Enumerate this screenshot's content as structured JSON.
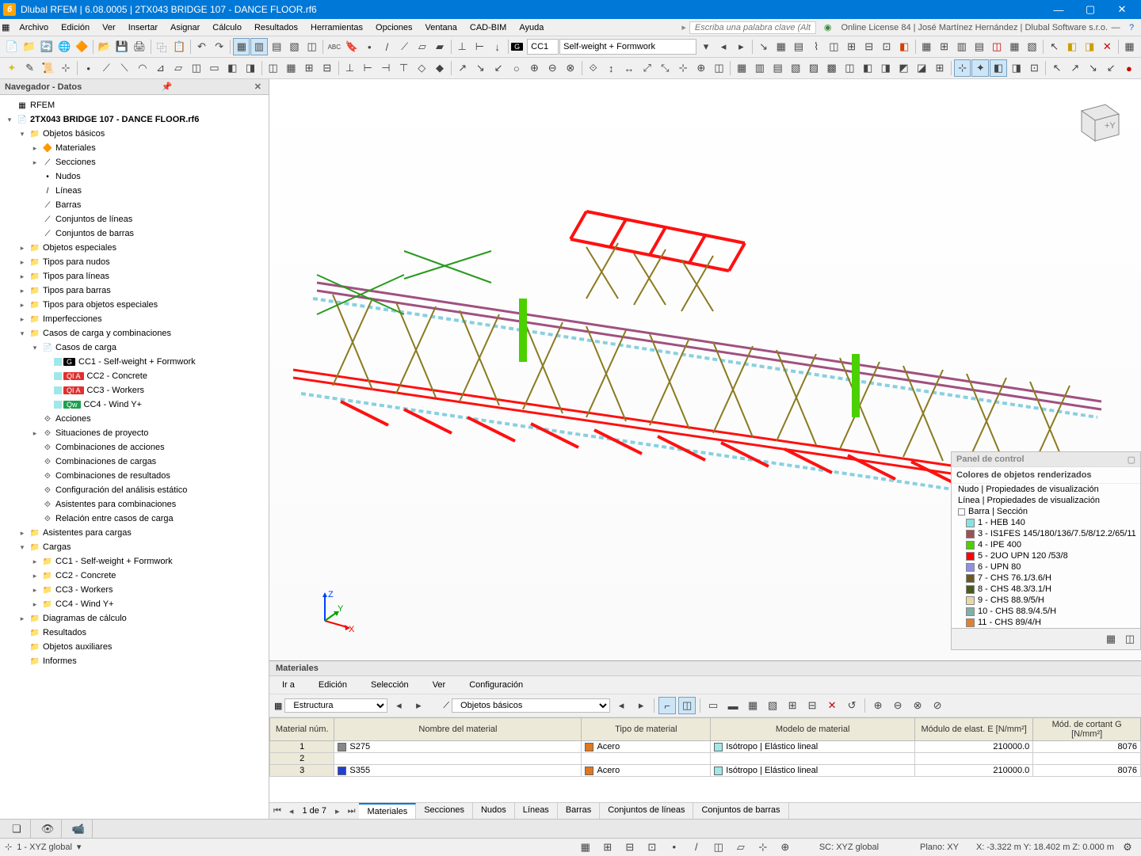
{
  "titlebar": {
    "title": "Dlubal RFEM | 6.08.0005 | 2TX043 BRIDGE 107 - DANCE FLOOR.rf6"
  },
  "menu": {
    "items": [
      "Archivo",
      "Edición",
      "Ver",
      "Insertar",
      "Asignar",
      "Cálculo",
      "Resultados",
      "Herramientas",
      "Opciones",
      "Ventana",
      "CAD-BIM",
      "Ayuda"
    ],
    "keyword_placeholder": "Escriba una palabra clave (Alt+Q)",
    "license": "Online License 84 | José Martínez Hernández | Dlubal Software s.r.o."
  },
  "toolbar1": {
    "cc_badge": "G",
    "cc_value": "CC1",
    "load_case": "Self-weight + Formwork"
  },
  "navigator": {
    "title": "Navegador - Datos",
    "root": "RFEM",
    "file": "2TX043 BRIDGE 107 - DANCE FLOOR.rf6",
    "basic_objects": "Objetos básicos",
    "basic_children": [
      "Materiales",
      "Secciones",
      "Nudos",
      "Líneas",
      "Barras",
      "Conjuntos de líneas",
      "Conjuntos de barras"
    ],
    "groups": [
      "Objetos especiales",
      "Tipos para nudos",
      "Tipos para líneas",
      "Tipos para barras",
      "Tipos para objetos especiales",
      "Imperfecciones"
    ],
    "loadcases_group": "Casos de carga y combinaciones",
    "loadcases_label": "Casos de carga",
    "cc": [
      {
        "badge": "G",
        "cls": "badge-g",
        "label": "CC1 - Self-weight + Formwork"
      },
      {
        "badge": "QI A",
        "cls": "badge-qia",
        "label": "CC2 - Concrete"
      },
      {
        "badge": "QI A",
        "cls": "badge-qia",
        "label": "CC3 - Workers"
      },
      {
        "badge": "Qw",
        "cls": "badge-qw",
        "label": "CC4 - Wind Y+"
      }
    ],
    "lc_sub": [
      "Acciones",
      "Situaciones de proyecto",
      "Combinaciones de acciones",
      "Combinaciones de cargas",
      "Combinaciones de resultados",
      "Configuración del análisis estático",
      "Asistentes para combinaciones",
      "Relación entre casos de carga"
    ],
    "after_lc": [
      "Asistentes para cargas"
    ],
    "loads": "Cargas",
    "load_children": [
      "CC1 - Self-weight + Formwork",
      "CC2 - Concrete",
      "CC3 - Workers",
      "CC4 - Wind Y+"
    ],
    "tail": [
      "Diagramas de cálculo",
      "Resultados",
      "Objetos auxiliares",
      "Informes"
    ]
  },
  "control_panel": {
    "title": "Panel de control",
    "sub": "Colores de objetos renderizados",
    "rows": [
      {
        "text": "Nudo | Propiedades de visualización"
      },
      {
        "text": "Línea | Propiedades de visualización"
      },
      {
        "text": "Barra | Sección",
        "boxed": true
      }
    ],
    "sections": [
      {
        "c": "#86e2e2",
        "t": "1 - HEB 140"
      },
      {
        "c": "#a05050",
        "t": "3 - IS1FES 145/180/136/7.5/8/12.2/65/11"
      },
      {
        "c": "#4bd000",
        "t": "4 - IPE 400"
      },
      {
        "c": "#ff0000",
        "t": "5 - 2UO UPN 120 /53/8"
      },
      {
        "c": "#9090e0",
        "t": "6 - UPN 80"
      },
      {
        "c": "#6a5a20",
        "t": "7 - CHS 76.1/3.6/H"
      },
      {
        "c": "#4a5a20",
        "t": "8 - CHS 48.3/3.1/H"
      },
      {
        "c": "#e8d8a8",
        "t": "9 - CHS 88.9/5/H"
      },
      {
        "c": "#80b0a8",
        "t": "10 - CHS 88.9/4.5/H"
      },
      {
        "c": "#e08030",
        "t": "11 - CHS 89/4/H"
      }
    ]
  },
  "materials": {
    "title": "Materiales",
    "menu": [
      "Ir a",
      "Edición",
      "Selección",
      "Ver",
      "Configuración"
    ],
    "select1": "Estructura",
    "select2": "Objetos básicos",
    "cols": {
      "num": "Material\nnúm.",
      "name": "Nombre del material",
      "type": "Tipo de\nmaterial",
      "model": "Modelo de material",
      "E": "Módulo de elast.\nE [N/mm²]",
      "G": "Mód. de cortant\nG [N/mm²]"
    },
    "rows": [
      {
        "n": "1",
        "sw": "#888",
        "name": "S275",
        "type": "Acero",
        "model": "Isótropo | Elástico lineal",
        "E": "210000.0",
        "G": "8076"
      },
      {
        "n": "2",
        "sw": "",
        "name": "",
        "type": "",
        "model": "",
        "E": "",
        "G": ""
      },
      {
        "n": "3",
        "sw": "#2040d0",
        "name": "S355",
        "type": "Acero",
        "model": "Isótropo | Elástico lineal",
        "E": "210000.0",
        "G": "8076"
      }
    ],
    "paging": "1 de 7",
    "tabs": [
      "Materiales",
      "Secciones",
      "Nudos",
      "Líneas",
      "Barras",
      "Conjuntos de líneas",
      "Conjuntos de barras"
    ]
  },
  "bottom": {
    "btns": [
      "❏",
      "👁",
      "📹"
    ]
  },
  "status": {
    "coord": "1 - XYZ global",
    "sc": "SC: XYZ global",
    "plano": "Plano: XY",
    "xyz": "X: -3.322 m   Y: 18.402 m   Z: 0.000 m"
  }
}
